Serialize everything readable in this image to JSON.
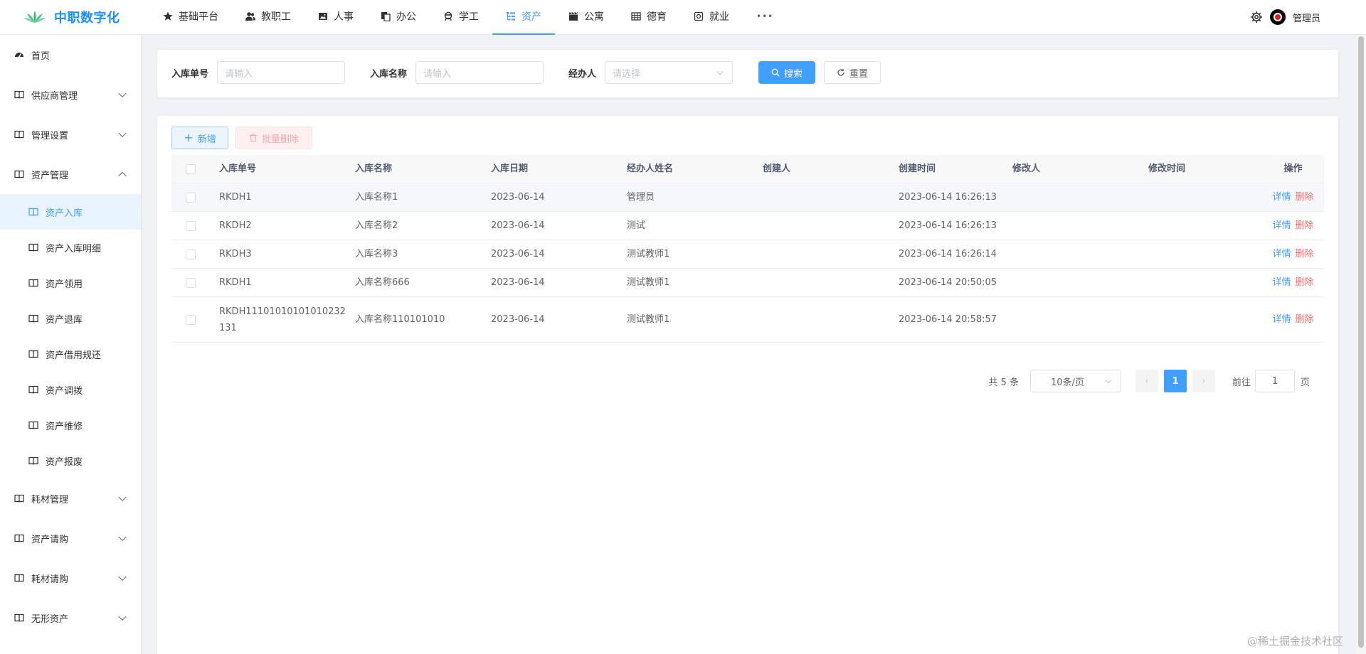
{
  "app": {
    "title": "中职数字化",
    "brand_color": "#1890ff"
  },
  "topnav": [
    {
      "label": "基础平台",
      "icon": "star-icon"
    },
    {
      "label": "教职工",
      "icon": "users-icon"
    },
    {
      "label": "人事",
      "icon": "image-icon"
    },
    {
      "label": "办公",
      "icon": "copy-icon"
    },
    {
      "label": "学工",
      "icon": "student-icon"
    },
    {
      "label": "资产",
      "icon": "tree-table-icon",
      "active": true
    },
    {
      "label": "公寓",
      "icon": "clapper-icon"
    },
    {
      "label": "德育",
      "icon": "grid-icon"
    },
    {
      "label": "就业",
      "icon": "target-icon"
    },
    {
      "label": "•••",
      "icon": "more-icon"
    }
  ],
  "user": {
    "name": "管理员"
  },
  "sidebar": {
    "home": "首页",
    "groups": [
      {
        "label": "供应商管理"
      },
      {
        "label": "管理设置"
      },
      {
        "label": "资产管理",
        "expanded": true
      }
    ],
    "asset_items": [
      {
        "label": "资产入库",
        "active": true
      },
      {
        "label": "资产入库明细"
      },
      {
        "label": "资产领用"
      },
      {
        "label": "资产退库"
      },
      {
        "label": "资产借用规还"
      },
      {
        "label": "资产调拨"
      },
      {
        "label": "资产维修"
      },
      {
        "label": "资产报废"
      }
    ],
    "groups_after": [
      {
        "label": "耗材管理"
      },
      {
        "label": "资产请购"
      },
      {
        "label": "耗材请购"
      },
      {
        "label": "无形资产"
      }
    ]
  },
  "search": {
    "field1_label": "入库单号",
    "field1_placeholder": "请输入",
    "field2_label": "入库名称",
    "field2_placeholder": "请输入",
    "field3_label": "经办人",
    "field3_placeholder": "请选择",
    "search_button": "搜索",
    "reset_button": "重置"
  },
  "toolbar": {
    "add_button": "新增",
    "batch_delete_button": "批量删除"
  },
  "table": {
    "headers": [
      "入库单号",
      "入库名称",
      "入库日期",
      "经办人姓名",
      "创建人",
      "创建时间",
      "修改人",
      "修改时间",
      "操作"
    ],
    "detail_label": "详情",
    "delete_label": "删除",
    "rows": [
      {
        "code": "RKDH1",
        "name": "入库名称1",
        "date": "2023-06-14",
        "handler": "管理员",
        "creator": "",
        "created": "2023-06-14 16:26:13",
        "modifier": "",
        "modified": ""
      },
      {
        "code": "RKDH2",
        "name": "入库名称2",
        "date": "2023-06-14",
        "handler": "测试",
        "creator": "",
        "created": "2023-06-14 16:26:13",
        "modifier": "",
        "modified": ""
      },
      {
        "code": "RKDH3",
        "name": "入库名称3",
        "date": "2023-06-14",
        "handler": "测试教师1",
        "creator": "",
        "created": "2023-06-14 16:26:14",
        "modifier": "",
        "modified": ""
      },
      {
        "code": "RKDH1",
        "name": "入库名称666",
        "date": "2023-06-14",
        "handler": "测试教师1",
        "creator": "",
        "created": "2023-06-14 20:50:05",
        "modifier": "",
        "modified": ""
      },
      {
        "code": "RKDH11101010101010232131",
        "name": "入库名称110101010",
        "date": "2023-06-14",
        "handler": "测试教师1",
        "creator": "",
        "created": "2023-06-14 20:58:57",
        "modifier": "",
        "modified": ""
      }
    ]
  },
  "pagination": {
    "total_text": "共 5 条",
    "page_size": "10条/页",
    "current_page": "1",
    "goto_label": "前往",
    "goto_value": "1",
    "page_suffix": "页"
  },
  "watermark": "@稀土掘金技术社区",
  "colors": {
    "primary": "#409eff",
    "danger": "#f56c6c"
  }
}
